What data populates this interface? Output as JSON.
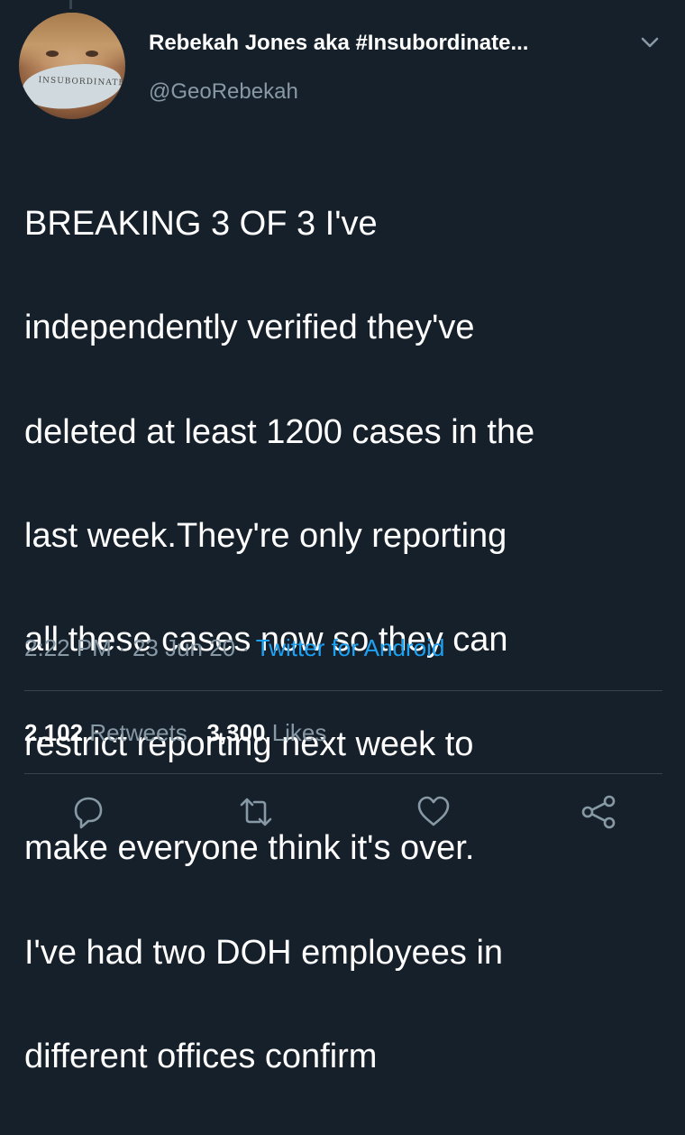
{
  "author": {
    "display_name": "Rebekah Jones aka #Insubordinate...",
    "handle": "@GeoRebekah",
    "avatar_mask_text": "INSUBORDINATE"
  },
  "tweet": {
    "lines": [
      "BREAKING 3 OF 3 I've",
      "independently verified they've",
      "deleted at least 1200 cases in the",
      "last week.They're only reporting",
      "all these cases now so they can",
      "restrict reporting next week to",
      "make everyone think it's over.",
      "I've had two DOH employees in",
      "different offices confirm"
    ],
    "time": "2:22 PM",
    "separator": " · ",
    "date": "23 Jun 20",
    "source": "Twitter for Android"
  },
  "stats": {
    "retweets_count": "2,102",
    "retweets_label": "Retweets",
    "likes_count": "3,300",
    "likes_label": "Likes"
  },
  "icons": {
    "caret": "chevron-down-icon",
    "reply": "reply-icon",
    "retweet": "retweet-icon",
    "like": "like-icon",
    "share": "share-icon"
  },
  "colors": {
    "background": "#15202b",
    "text_primary": "#ffffff",
    "text_secondary": "#8899a6",
    "link": "#1da1f2",
    "divider": "#38444d"
  }
}
